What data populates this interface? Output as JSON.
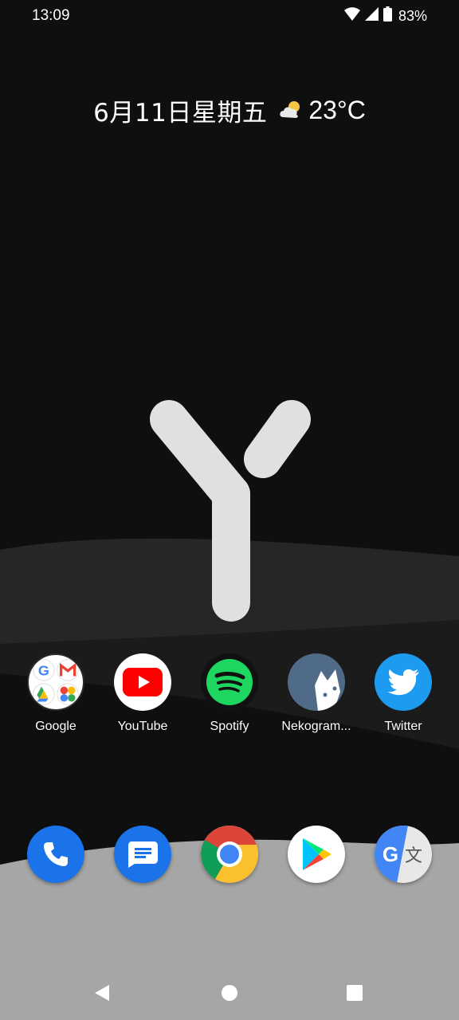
{
  "status_bar": {
    "time": "13:09",
    "battery_percent": "83%",
    "icons": [
      "wifi-icon",
      "cell-signal-icon",
      "battery-icon"
    ]
  },
  "glance": {
    "date": "6月11日星期五",
    "weather_icon": "partly-cloudy-icon",
    "temperature": "23°C"
  },
  "home_apps": [
    {
      "label": "Google",
      "icon": "google-folder-icon"
    },
    {
      "label": "YouTube",
      "icon": "youtube-icon"
    },
    {
      "label": "Spotify",
      "icon": "spotify-icon"
    },
    {
      "label": "Nekogram...",
      "icon": "nekogram-icon"
    },
    {
      "label": "Twitter",
      "icon": "twitter-icon"
    }
  ],
  "dock": [
    "phone-icon",
    "messages-icon",
    "chrome-icon",
    "play-store-icon",
    "google-translate-icon"
  ],
  "navigation": [
    "back-icon",
    "home-icon",
    "recents-icon"
  ],
  "colors": {
    "background": "#0f0f10",
    "wave_dark": "#262626",
    "wave_light": "#a6a6a6",
    "logo": "#e0e0e0"
  }
}
